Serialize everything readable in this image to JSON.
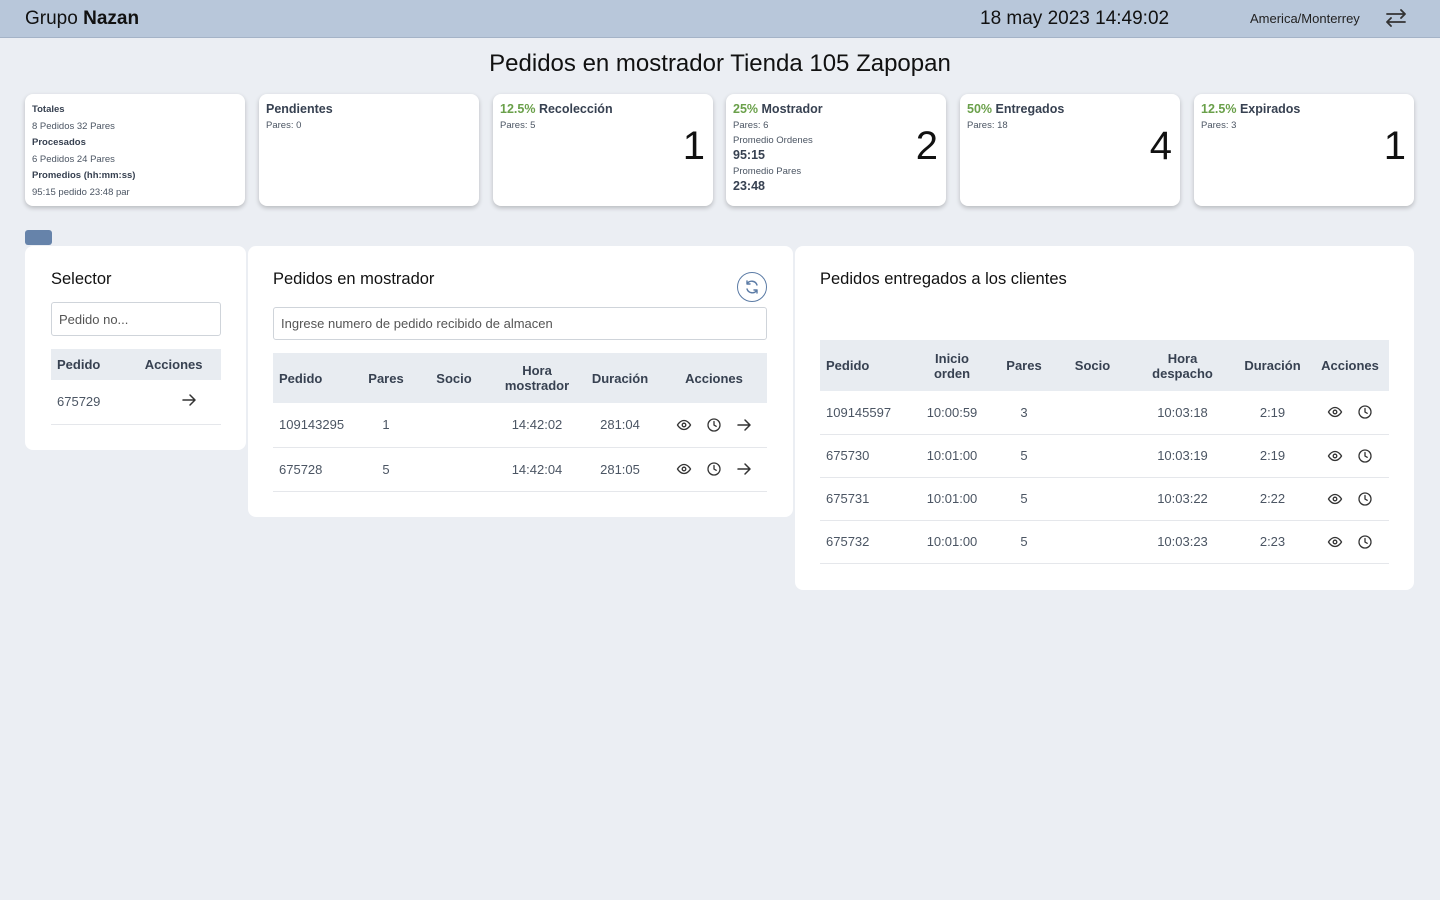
{
  "header": {
    "brand_prefix": "Grupo",
    "brand_name": "Nazan",
    "datetime": "18 may 2023 14:49:02",
    "timezone": "America/Monterrey"
  },
  "page_title": "Pedidos en mostrador Tienda 105 Zapopan",
  "summary": {
    "totales_label": "Totales",
    "totales_value": "8 Pedidos 32 Pares",
    "procesados_label": "Procesados",
    "procesados_value": "6 Pedidos 24 Pares",
    "promedios_label": "Promedios (hh:mm:ss)",
    "promedios_value": "95:15 pedido 23:48 par"
  },
  "cards": {
    "pendientes": {
      "pct": "",
      "title": "Pendientes",
      "pares": "Pares: 0",
      "count": ""
    },
    "recoleccion": {
      "pct": "12.5%",
      "title": "Recolección",
      "pares": "Pares: 5",
      "count": "1"
    },
    "mostrador": {
      "pct": "25%",
      "title": "Mostrador",
      "pares": "Pares: 6",
      "count": "2",
      "prom_ordenes_label": "Promedio Ordenes",
      "prom_ordenes": "95:15",
      "prom_pares_label": "Promedio Pares",
      "prom_pares": "23:48"
    },
    "entregados": {
      "pct": "50%",
      "title": "Entregados",
      "pares": "Pares: 18",
      "count": "4"
    },
    "expirados": {
      "pct": "12.5%",
      "title": "Expirados",
      "pares": "Pares: 3",
      "count": "1"
    }
  },
  "selector": {
    "title": "Selector",
    "placeholder": "Pedido no...",
    "columns": [
      "Pedido",
      "Acciones"
    ],
    "rows": [
      {
        "pedido": "675729"
      }
    ]
  },
  "mostrador_panel": {
    "title": "Pedidos en mostrador",
    "placeholder": "Ingrese numero de pedido recibido de almacen",
    "columns": [
      "Pedido",
      "Pares",
      "Socio",
      "Hora mostrador",
      "Duración",
      "Acciones"
    ],
    "rows": [
      {
        "pedido": "109143295",
        "pares": "1",
        "socio": "",
        "hora": "14:42:02",
        "duracion": "281:04"
      },
      {
        "pedido": "675728",
        "pares": "5",
        "socio": "",
        "hora": "14:42:04",
        "duracion": "281:05"
      }
    ]
  },
  "entregados_panel": {
    "title": "Pedidos entregados a los clientes",
    "columns": [
      "Pedido",
      "Inicio orden",
      "Pares",
      "Socio",
      "Hora despacho",
      "Duración",
      "Acciones"
    ],
    "rows": [
      {
        "pedido": "109145597",
        "inicio": "10:00:59",
        "pares": "3",
        "socio": "",
        "hora": "10:03:18",
        "duracion": "2:19"
      },
      {
        "pedido": "675730",
        "inicio": "10:01:00",
        "pares": "5",
        "socio": "",
        "hora": "10:03:19",
        "duracion": "2:19"
      },
      {
        "pedido": "675731",
        "inicio": "10:01:00",
        "pares": "5",
        "socio": "",
        "hora": "10:03:22",
        "duracion": "2:22"
      },
      {
        "pedido": "675732",
        "inicio": "10:01:00",
        "pares": "5",
        "socio": "",
        "hora": "10:03:23",
        "duracion": "2:23"
      }
    ]
  },
  "colors": {
    "topbar": "#b8c7da",
    "accent": "#6683aa",
    "pct_green": "#6aa04a"
  }
}
